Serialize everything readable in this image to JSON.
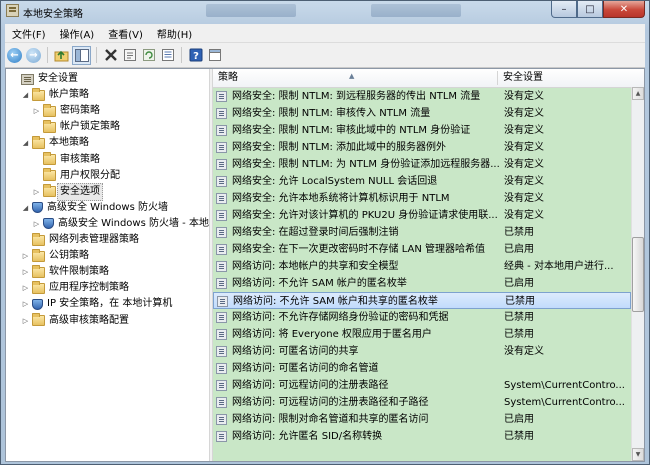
{
  "window": {
    "title": "本地安全策略"
  },
  "menu": [
    "文件(F)",
    "操作(A)",
    "查看(V)",
    "帮助(H)"
  ],
  "toolbar": {
    "icons": [
      "back-arrow-icon",
      "forward-arrow-icon",
      "up-folder-icon",
      "show-hide-tree-icon",
      "delete-icon",
      "properties-icon",
      "refresh-icon",
      "export-list-icon",
      "help-icon",
      "console-icon"
    ]
  },
  "tree": [
    {
      "label": "安全设置",
      "level": 0,
      "expander": "",
      "icon": "policy"
    },
    {
      "label": "帐户策略",
      "level": 1,
      "expander": "open",
      "icon": "folder"
    },
    {
      "label": "密码策略",
      "level": 2,
      "expander": "closed",
      "icon": "folder"
    },
    {
      "label": "帐户锁定策略",
      "level": 2,
      "expander": "",
      "icon": "folder"
    },
    {
      "label": "本地策略",
      "level": 1,
      "expander": "open",
      "icon": "folder"
    },
    {
      "label": "审核策略",
      "level": 2,
      "expander": "",
      "icon": "folder"
    },
    {
      "label": "用户权限分配",
      "level": 2,
      "expander": "",
      "icon": "folder"
    },
    {
      "label": "安全选项",
      "level": 2,
      "expander": "closed",
      "icon": "folder",
      "selected": true
    },
    {
      "label": "高级安全 Windows 防火墙",
      "level": 1,
      "expander": "open",
      "icon": "shield"
    },
    {
      "label": "高级安全 Windows 防火墙 - 本地组策略对象",
      "level": 2,
      "expander": "closed",
      "icon": "shield"
    },
    {
      "label": "网络列表管理器策略",
      "level": 1,
      "expander": "",
      "icon": "folder"
    },
    {
      "label": "公钥策略",
      "level": 1,
      "expander": "closed",
      "icon": "folder"
    },
    {
      "label": "软件限制策略",
      "level": 1,
      "expander": "closed",
      "icon": "folder"
    },
    {
      "label": "应用程序控制策略",
      "level": 1,
      "expander": "closed",
      "icon": "folder"
    },
    {
      "label": "IP 安全策略，在 本地计算机",
      "level": 1,
      "expander": "closed",
      "icon": "shield"
    },
    {
      "label": "高级审核策略配置",
      "level": 1,
      "expander": "closed",
      "icon": "folder"
    }
  ],
  "list": {
    "columns": [
      "策略",
      "安全设置"
    ],
    "rows": [
      {
        "policy": "网络安全: 限制 NTLM: 到远程服务器的传出 NTLM 流量",
        "setting": "没有定义"
      },
      {
        "policy": "网络安全: 限制 NTLM: 审核传入 NTLM 流量",
        "setting": "没有定义"
      },
      {
        "policy": "网络安全: 限制 NTLM: 审核此域中的 NTLM 身份验证",
        "setting": "没有定义"
      },
      {
        "policy": "网络安全: 限制 NTLM: 添加此域中的服务器例外",
        "setting": "没有定义"
      },
      {
        "policy": "网络安全: 限制 NTLM: 为 NTLM 身份验证添加远程服务器...",
        "setting": "没有定义"
      },
      {
        "policy": "网络安全: 允许 LocalSystem NULL 会话回退",
        "setting": "没有定义"
      },
      {
        "policy": "网络安全: 允许本地系统将计算机标识用于 NTLM",
        "setting": "没有定义"
      },
      {
        "policy": "网络安全: 允许对该计算机的 PKU2U 身份验证请求使用联...",
        "setting": "没有定义"
      },
      {
        "policy": "网络安全: 在超过登录时间后强制注销",
        "setting": "已禁用"
      },
      {
        "policy": "网络安全: 在下一次更改密码时不存储 LAN 管理器哈希值",
        "setting": "已启用"
      },
      {
        "policy": "网络访问: 本地帐户的共享和安全模型",
        "setting": "经典 - 对本地用户进行..."
      },
      {
        "policy": "网络访问: 不允许 SAM 帐户的匿名枚举",
        "setting": "已启用"
      },
      {
        "policy": "网络访问: 不允许 SAM 帐户和共享的匿名枚举",
        "setting": "已禁用",
        "selected": true
      },
      {
        "policy": "网络访问: 不允许存储网络身份验证的密码和凭据",
        "setting": "已禁用"
      },
      {
        "policy": "网络访问: 将 Everyone 权限应用于匿名用户",
        "setting": "已禁用"
      },
      {
        "policy": "网络访问: 可匿名访问的共享",
        "setting": "没有定义"
      },
      {
        "policy": "网络访问: 可匿名访问的命名管道",
        "setting": ""
      },
      {
        "policy": "网络访问: 可远程访问的注册表路径",
        "setting": "System\\CurrentContro..."
      },
      {
        "policy": "网络访问: 可远程访问的注册表路径和子路径",
        "setting": "System\\CurrentContro..."
      },
      {
        "policy": "网络访问: 限制对命名管道和共享的匿名访问",
        "setting": "已启用"
      },
      {
        "policy": "网络访问: 允许匿名 SID/名称转换",
        "setting": "已禁用"
      }
    ]
  }
}
